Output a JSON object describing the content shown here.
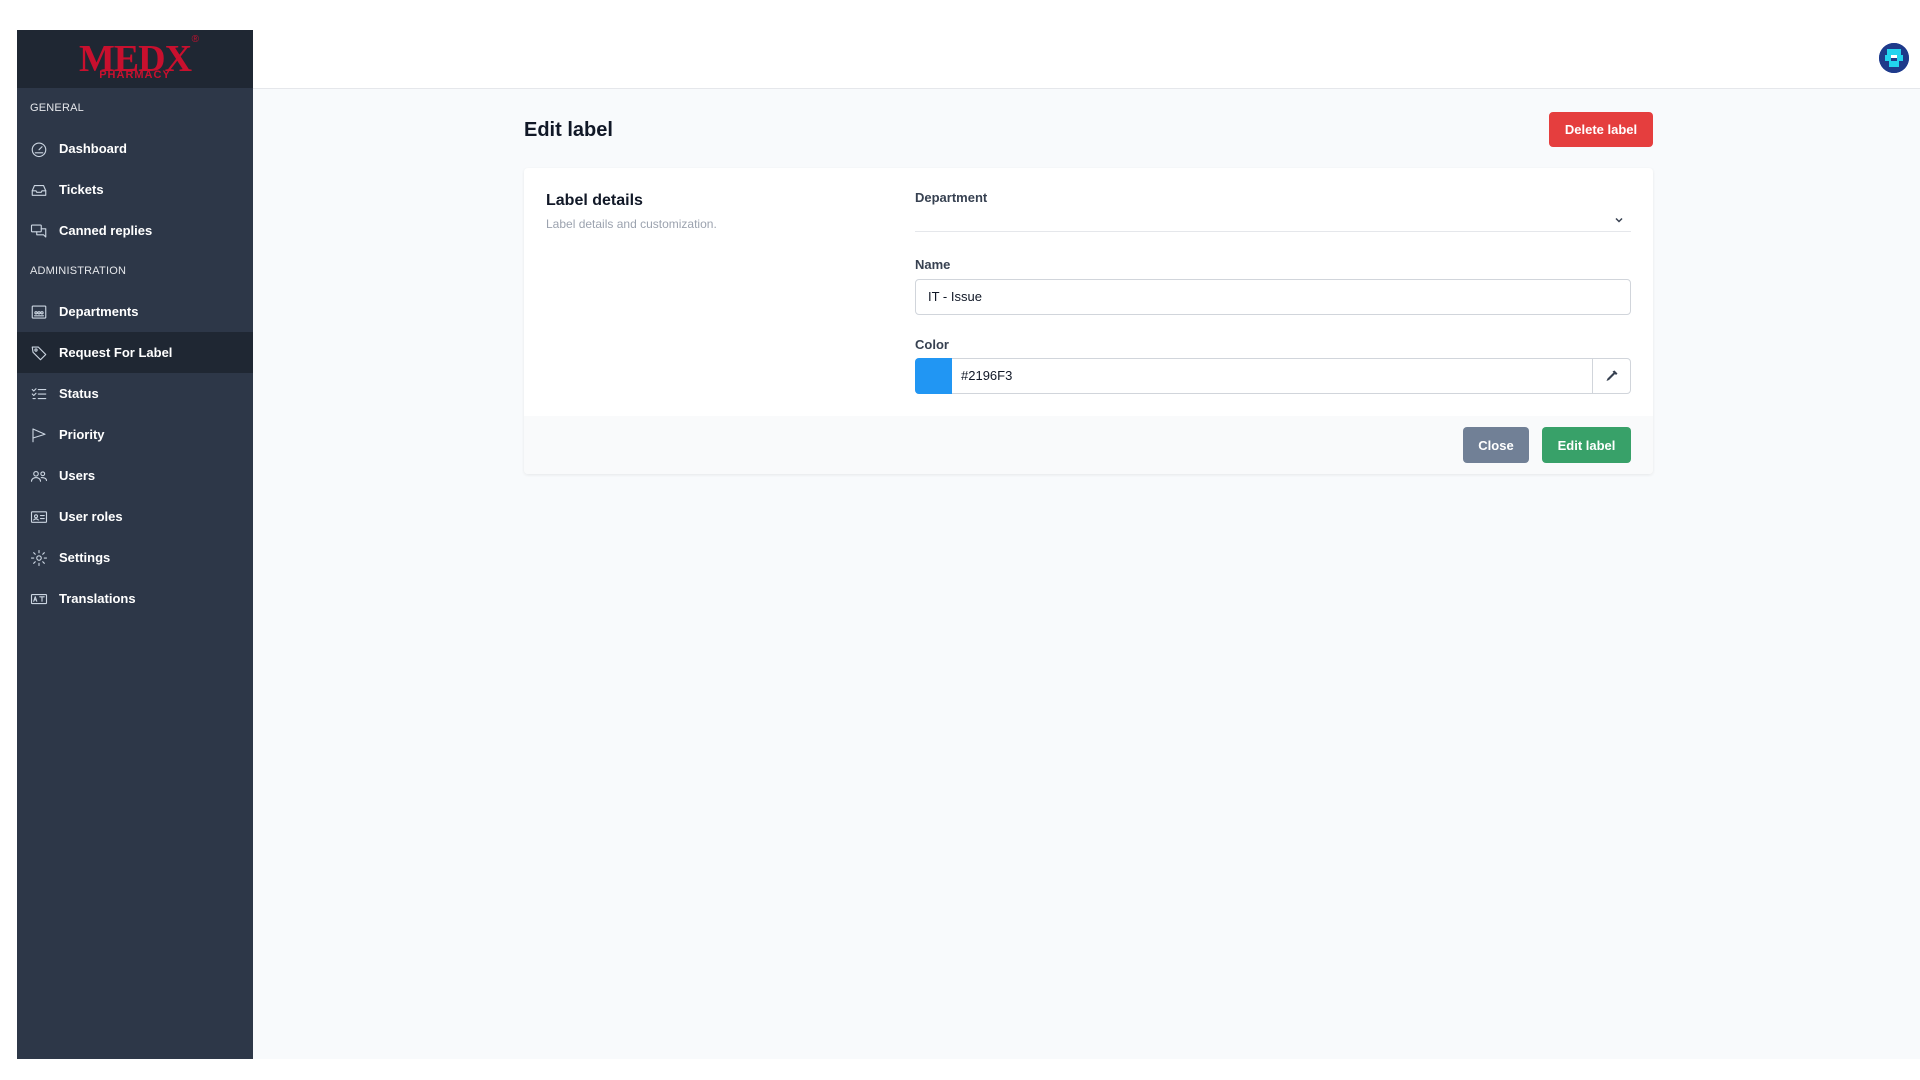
{
  "brand": {
    "logo_main": "MEDX",
    "logo_sub": "PHARMACY",
    "logo_reg": "®",
    "logo_color": "#c8102e"
  },
  "sidebar": {
    "sections": [
      {
        "title": "GENERAL",
        "items": [
          {
            "label": "Dashboard",
            "icon": "dashboard-gauge-icon"
          },
          {
            "label": "Tickets",
            "icon": "inbox-icon"
          },
          {
            "label": "Canned replies",
            "icon": "chat-bubbles-icon"
          }
        ]
      },
      {
        "title": "ADMINISTRATION",
        "items": [
          {
            "label": "Departments",
            "icon": "departments-icon"
          },
          {
            "label": "Request For Label",
            "icon": "tag-icon",
            "active": true
          },
          {
            "label": "Status",
            "icon": "checklist-icon"
          },
          {
            "label": "Priority",
            "icon": "flag-icon"
          },
          {
            "label": "Users",
            "icon": "users-icon"
          },
          {
            "label": "User roles",
            "icon": "id-card-icon"
          },
          {
            "label": "Settings",
            "icon": "gear-icon"
          },
          {
            "label": "Translations",
            "icon": "translate-icon"
          }
        ]
      }
    ]
  },
  "header": {
    "avatar_icon": "user-avatar-icon"
  },
  "page": {
    "title": "Edit label",
    "delete_label": "Delete label"
  },
  "card": {
    "title": "Label details",
    "subtitle": "Label details and customization.",
    "department_label": "Department",
    "department_value": "",
    "name_label": "Name",
    "name_value": "IT - Issue",
    "color_label": "Color",
    "color_value": "#2196F3",
    "picker_icon": "eyedropper-icon"
  },
  "footer": {
    "close_label": "Close",
    "edit_label": "Edit label"
  },
  "colors": {
    "sidebar": "#2d3748",
    "sidebar_active": "#1f2733",
    "danger": "#e53e3e",
    "success": "#38a169",
    "secondary": "#718096",
    "swatch": "#2196F3"
  }
}
